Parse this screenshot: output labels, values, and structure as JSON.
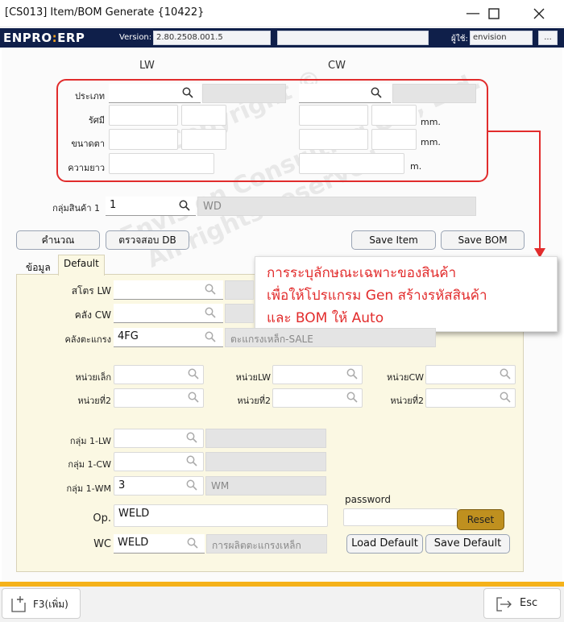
{
  "window": {
    "title": "[CS013] Item/BOM Generate {10422}",
    "controls": [
      "minimize",
      "maximize",
      "close"
    ]
  },
  "header": {
    "logo_left": "ENPRO",
    "logo_sep": ":",
    "logo_right": "ERP",
    "version_label": "Version:",
    "version_value": "2.80.2508.001.5",
    "blank_value": "",
    "user_label": "ผู้ใช้:",
    "user_value": "envision",
    "more_label": "..."
  },
  "columns": {
    "lw": "LW",
    "cw": "CW"
  },
  "spec": {
    "type_label": "ประเภท",
    "radius_label": "รัศมี",
    "eye_label": "ขนาดตา",
    "length_label": "ความยาว",
    "unit_mm": "mm.",
    "unit_m": "m."
  },
  "product_group": {
    "label": "กลุ่มสินค้า 1",
    "code": "1",
    "name": "WD"
  },
  "actions": {
    "calc": "คำนวณ",
    "check_db": "ตรวจสอบ DB",
    "save_item": "Save Item",
    "save_bom": "Save BOM"
  },
  "callout": {
    "line1": "การระบุลักษณะเฉพาะของสินค้า",
    "line2": "เพื่อให้โปรแกรม Gen สร้างรหัสสินค้า",
    "line3": "และ BOM ให้ Auto"
  },
  "tabs": {
    "data": "ข้อมูล",
    "default": "Default"
  },
  "defaults": {
    "store_lw_label": "สโตร  LW",
    "store_cw_label": "คลัง CW",
    "wh_frame_label": "คลังตะแกรง",
    "wh_frame_code": "4FG",
    "wh_frame_name": "ตะแกรงเหล็ก-SALE",
    "unit_small_label": "หน่วยเล็ก",
    "unit_lw_label": "หน่วยLW",
    "unit_cw_label": "หน่วยCW",
    "unit2_label": "หน่วยที่2",
    "grp_lw_label": "กลุ่ม 1-LW",
    "grp_cw_label": "กลุ่ม 1-CW",
    "grp_wm_label": "กลุ่ม 1-WM",
    "grp_wm_code": "3",
    "grp_wm_name": "WM",
    "op_label": "Op.",
    "op_value": "WELD",
    "wc_label": "WC",
    "wc_code": "WELD",
    "wc_name": "การผลิตตะแกรงเหล็ก",
    "password_label": "password",
    "reset": "Reset",
    "load_default": "Load Default",
    "save_default": "Save Default"
  },
  "footer": {
    "new_button": "F3(เพิ่ม)",
    "esc_button": "Esc"
  },
  "watermark": {
    "w1": "Copyright ©",
    "w2": "Envision Consulting Co., Ltd.",
    "w3": "All rights reserved."
  },
  "colors": {
    "header_bg": "#0f1f4a",
    "annotation_red": "#e22c2c",
    "accent_orange": "#f5b21a",
    "reset_button": "#bf901f",
    "tab_panel_bg": "#fbf8e3"
  }
}
